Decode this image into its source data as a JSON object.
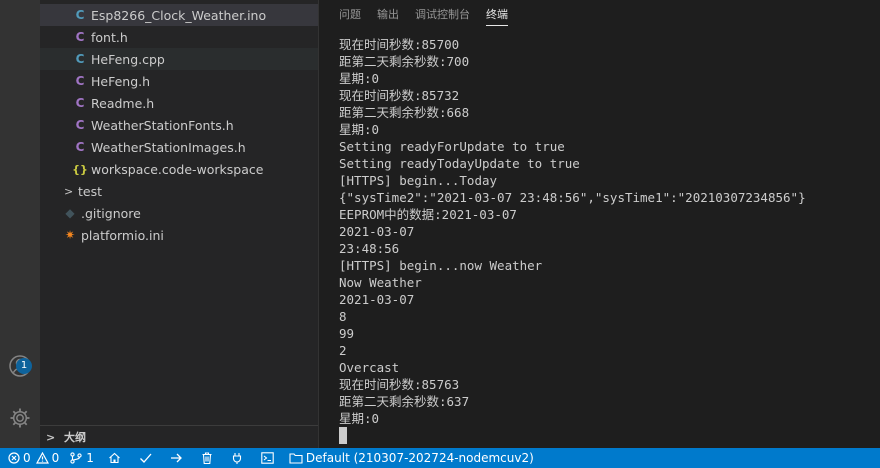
{
  "sidebar": {
    "files": [
      {
        "name": "Esp8266_Clock_Weather.ino",
        "icon": "cpp-file-icon",
        "glyph": "C"
      },
      {
        "name": "font.h",
        "icon": "c-header-icon",
        "glyph": "C"
      },
      {
        "name": "HeFeng.cpp",
        "icon": "cpp-file-icon",
        "glyph": "C"
      },
      {
        "name": "HeFeng.h",
        "icon": "c-header-icon",
        "glyph": "C"
      },
      {
        "name": "Readme.h",
        "icon": "c-header-icon",
        "glyph": "C"
      },
      {
        "name": "WeatherStationFonts.h",
        "icon": "c-header-icon",
        "glyph": "C"
      },
      {
        "name": "WeatherStationImages.h",
        "icon": "c-header-icon",
        "glyph": "C"
      },
      {
        "name": "workspace.code-workspace",
        "icon": "json-file-icon",
        "glyph": "{}"
      }
    ],
    "folders": [
      {
        "name": "test",
        "glyph": ">"
      }
    ],
    "root_files": [
      {
        "name": ".gitignore",
        "icon": "git-file-icon",
        "glyph": "◆"
      },
      {
        "name": "platformio.ini",
        "icon": "platformio-icon",
        "glyph": "✷"
      }
    ],
    "outline_label": "大纲",
    "outline_glyph": ">"
  },
  "activity": {
    "accounts_badge": "1"
  },
  "panel": {
    "tabs": [
      "问题",
      "输出",
      "调试控制台",
      "终端"
    ],
    "active_tab": "终端",
    "terminal_lines": [
      "现在时间秒数:85700",
      "距第二天剩余秒数:700",
      "星期:0",
      "现在时间秒数:85732",
      "距第二天剩余秒数:668",
      "星期:0",
      "Setting readyForUpdate to true",
      "Setting readyTodayUpdate to true",
      "[HTTPS] begin...Today",
      "{\"sysTime2\":\"2021-03-07 23:48:56\",\"sysTime1\":\"20210307234856\"}",
      "EEPROM中的数据:2021-03-07",
      "2021-03-07",
      "23:48:56",
      "[HTTPS] begin...now Weather",
      "Now Weather",
      "2021-03-07",
      "8",
      "99",
      "2",
      "Overcast",
      "现在时间秒数:85763",
      "距第二天剩余秒数:637",
      "星期:0"
    ]
  },
  "status_bar": {
    "errors": "0",
    "warnings": "0",
    "sync_count": "1",
    "environment": "Default (210307-202724-nodemcuv2)"
  },
  "colors": {
    "status_bar": "#007acc",
    "sidebar": "#252526",
    "activity_bar": "#333333",
    "editor": "#1e1e1e"
  }
}
